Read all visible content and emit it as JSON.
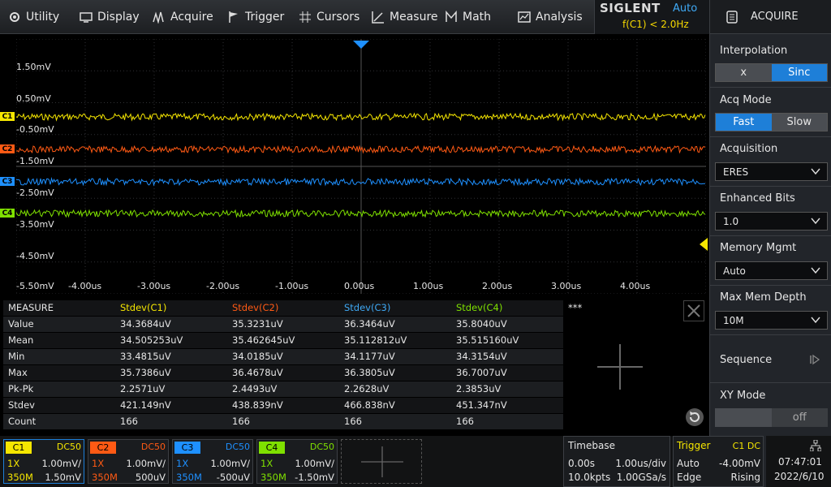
{
  "menu": [
    {
      "label": "Utility",
      "icon": "utility-icon"
    },
    {
      "label": "Display",
      "icon": "display-icon"
    },
    {
      "label": "Acquire",
      "icon": "acquire-icon"
    },
    {
      "label": "Trigger",
      "icon": "trigger-flag-icon"
    },
    {
      "label": "Cursors",
      "icon": "cursors-icon"
    },
    {
      "label": "Measure",
      "icon": "measure-icon"
    },
    {
      "label": "Math",
      "icon": "math-icon"
    },
    {
      "label": "Analysis",
      "icon": "analysis-icon"
    }
  ],
  "brand": {
    "logo": "SIGLENT",
    "mode": "Auto",
    "frequency": "f(C1) < 2.0Hz"
  },
  "panel": {
    "title": "ACQUIRE",
    "interpolation": {
      "label": "Interpolation",
      "options": [
        "x",
        "Sinc"
      ],
      "selected": "Sinc"
    },
    "acq_mode": {
      "label": "Acq Mode",
      "options": [
        "Fast",
        "Slow"
      ],
      "selected": "Fast"
    },
    "acquisition": {
      "label": "Acquisition",
      "value": "ERES"
    },
    "enhanced_bits": {
      "label": "Enhanced Bits",
      "value": "1.0"
    },
    "memory_mgmt": {
      "label": "Memory Mgmt",
      "value": "Auto"
    },
    "max_mem_depth": {
      "label": "Max Mem Depth",
      "value": "10M"
    },
    "sequence": {
      "label": "Sequence"
    },
    "xy_mode": {
      "label": "XY Mode",
      "value": "off"
    }
  },
  "grid": {
    "voltage_labels": [
      "1.50mV",
      "0.50mV",
      "-0.50mV",
      "-1.50mV",
      "-2.50mV",
      "-3.50mV",
      "-4.50mV",
      "-5.50mV"
    ],
    "time_labels": [
      "-4.00us",
      "-3.00us",
      "-2.00us",
      "-1.00us",
      "0.00us",
      "1.00us",
      "2.00us",
      "3.00us",
      "4.00us"
    ],
    "channels": [
      {
        "label": "C1",
        "color": "#f5e600"
      },
      {
        "label": "C2",
        "color": "#ff5a14"
      },
      {
        "label": "C3",
        "color": "#1e90ff"
      },
      {
        "label": "C4",
        "color": "#7fe000"
      }
    ]
  },
  "measure": {
    "header": "MEASURE",
    "columns": [
      {
        "label": "Stdev(C1)",
        "color": "#f5e600"
      },
      {
        "label": "Stdev(C2)",
        "color": "#ff5a14"
      },
      {
        "label": "Stdev(C3)",
        "color": "#3fa9f5"
      },
      {
        "label": "Stdev(C4)",
        "color": "#7fe000"
      },
      {
        "label": "***",
        "color": "#e6e6e6"
      }
    ],
    "rows": [
      {
        "name": "Value",
        "cells": [
          "34.3684uV",
          "35.3231uV",
          "36.3464uV",
          "35.8040uV"
        ]
      },
      {
        "name": "Mean",
        "cells": [
          "34.505253uV",
          "35.462645uV",
          "35.112812uV",
          "35.515160uV"
        ]
      },
      {
        "name": "Min",
        "cells": [
          "33.4815uV",
          "34.0185uV",
          "34.1177uV",
          "34.3154uV"
        ]
      },
      {
        "name": "Max",
        "cells": [
          "35.7386uV",
          "36.4678uV",
          "36.3805uV",
          "36.7007uV"
        ]
      },
      {
        "name": "Pk-Pk",
        "cells": [
          "2.2571uV",
          "2.4493uV",
          "2.2628uV",
          "2.3853uV"
        ]
      },
      {
        "name": "Stdev",
        "cells": [
          "421.149nV",
          "438.839nV",
          "466.838nV",
          "451.347nV"
        ]
      },
      {
        "name": "Count",
        "cells": [
          "166",
          "166",
          "166",
          "166"
        ]
      }
    ]
  },
  "channels_bar": [
    {
      "tag": "C1",
      "coupling": "DC50",
      "probe": "1X",
      "scale": "1.00mV/",
      "bw": "350M",
      "offset": "1.50mV",
      "color": "#f5e600"
    },
    {
      "tag": "C2",
      "coupling": "DC50",
      "probe": "1X",
      "scale": "1.00mV/",
      "bw": "350M",
      "offset": "500uV",
      "color": "#ff5a14"
    },
    {
      "tag": "C3",
      "coupling": "DC50",
      "probe": "1X",
      "scale": "1.00mV/",
      "bw": "350M",
      "offset": "-500uV",
      "color": "#1e90ff"
    },
    {
      "tag": "C4",
      "coupling": "DC50",
      "probe": "1X",
      "scale": "1.00mV/",
      "bw": "350M",
      "offset": "-1.50mV",
      "color": "#7fe000"
    }
  ],
  "timebase": {
    "label": "Timebase",
    "delay": "0.00s",
    "scale": "1.00us/div",
    "points": "10.0kpts",
    "rate": "1.00GSa/s"
  },
  "trigger": {
    "label": "Trigger",
    "source": "C1 DC",
    "mode": "Auto",
    "level": "-4.00mV",
    "type": "Edge",
    "slope": "Rising"
  },
  "clock": {
    "time": "07:47:01",
    "date": "2022/6/10"
  }
}
